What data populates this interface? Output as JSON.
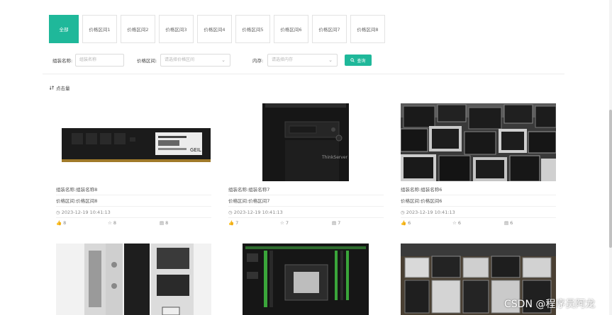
{
  "tabs": [
    "全部",
    "价格区间1",
    "价格区间2",
    "价格区间3",
    "价格区间4",
    "价格区间5",
    "价格区间6",
    "价格区间7",
    "价格区间8"
  ],
  "filters": {
    "name_label": "组装名称:",
    "name_placeholder": "组装名称",
    "price_label": "价格区间:",
    "price_placeholder": "请选择价格区间",
    "memory_label": "内存:",
    "memory_placeholder": "请选择内存",
    "search_label": "查询"
  },
  "sort": {
    "label": "点击量"
  },
  "cards": [
    {
      "name": "组装名称:组装名称8",
      "price": "价格区间:价格区间8",
      "date": "2023-12-19 10:41:13",
      "likes": "8",
      "stars": "8",
      "comments": "8"
    },
    {
      "name": "组装名称:组装名称7",
      "price": "价格区间:价格区间7",
      "date": "2023-12-19 10:41:13",
      "likes": "7",
      "stars": "7",
      "comments": "7"
    },
    {
      "name": "组装名称:组装名称6",
      "price": "价格区间:价格区间6",
      "date": "2023-12-19 10:41:13",
      "likes": "6",
      "stars": "6",
      "comments": "6"
    }
  ],
  "ram_label": "GEIL",
  "server_label": "ThinkServer",
  "watermark": "CSDN @程序员阿龙",
  "colors": {
    "accent": "#1fb89a"
  }
}
